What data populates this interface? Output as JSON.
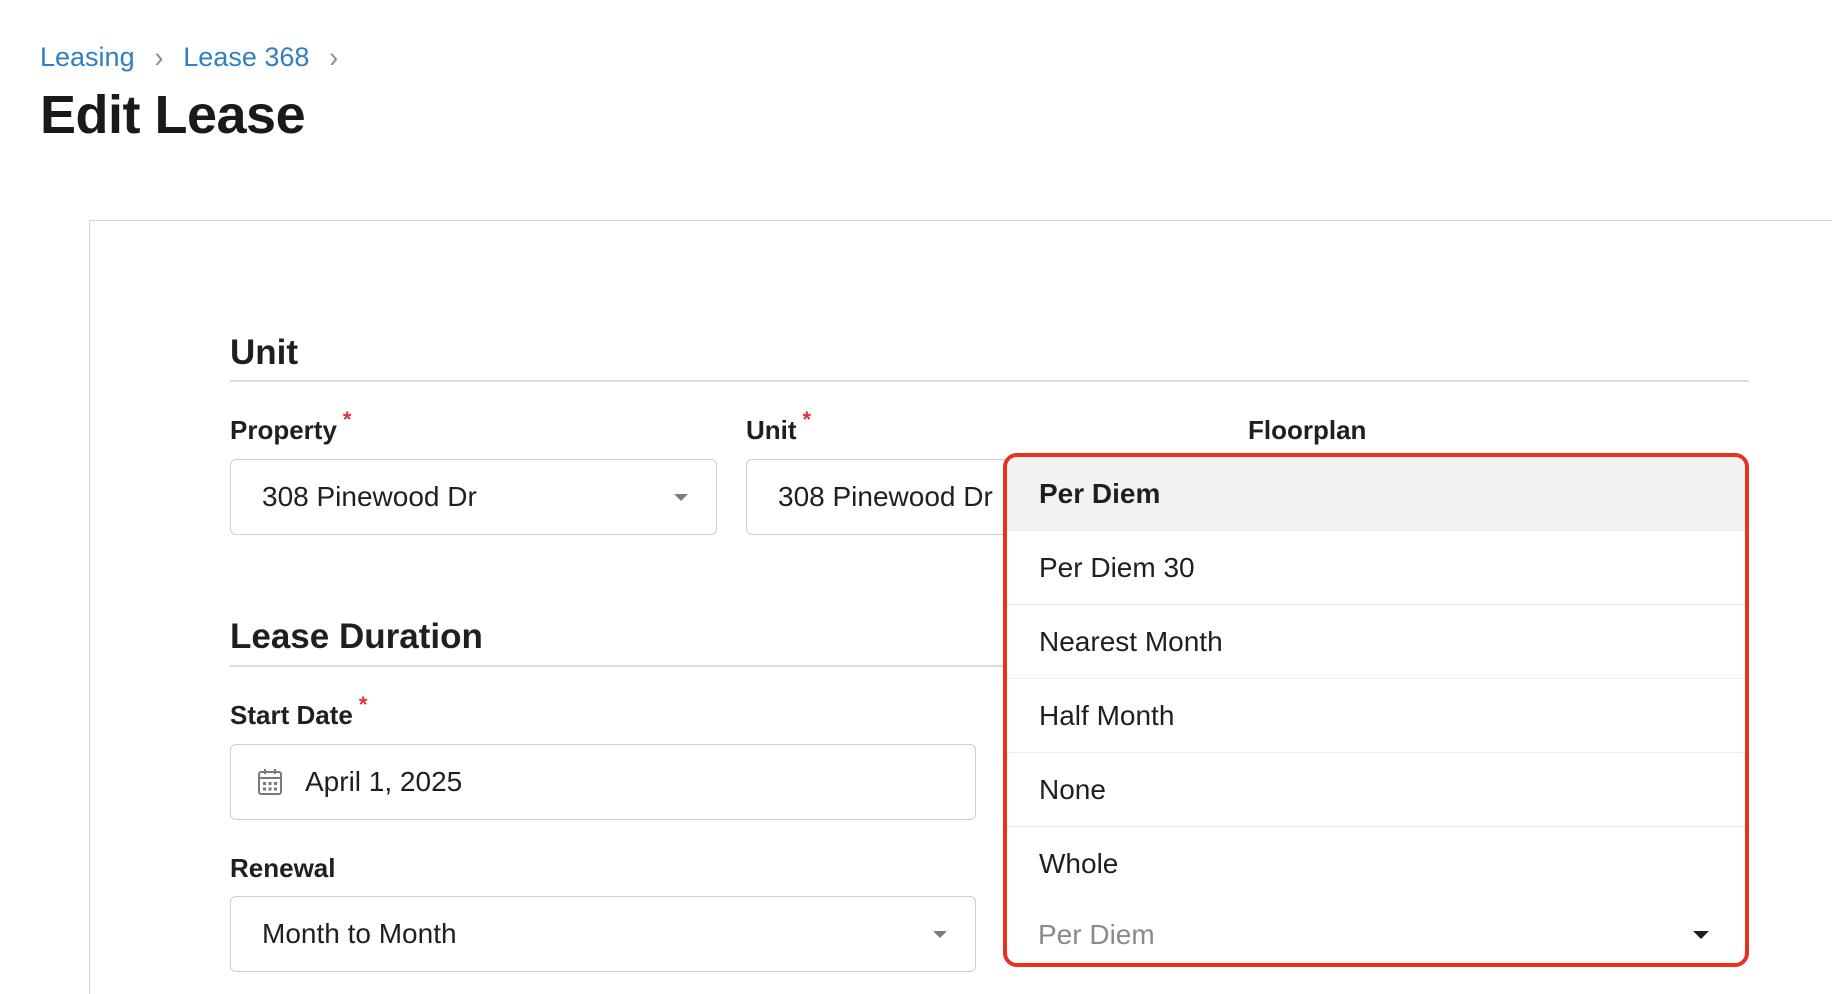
{
  "breadcrumb": {
    "items": [
      {
        "label": "Leasing"
      },
      {
        "label": "Lease 368"
      }
    ],
    "separator": "›"
  },
  "page": {
    "title": "Edit Lease"
  },
  "unit_section": {
    "title": "Unit",
    "property": {
      "label": "Property",
      "required_mark": "*",
      "value": "308 Pinewood Dr"
    },
    "unit": {
      "label": "Unit",
      "required_mark": "*",
      "value": "308 Pinewood Dr"
    },
    "floorplan": {
      "label": "Floorplan"
    }
  },
  "lease_duration_section": {
    "title": "Lease Duration",
    "start_date": {
      "label": "Start Date",
      "required_mark": "*",
      "value": "April 1, 2025",
      "icon": "calendar-icon"
    },
    "renewal": {
      "label": "Renewal",
      "value": "Month to Month"
    }
  },
  "proration_dropdown": {
    "options": [
      {
        "label": "Per Diem",
        "active": true
      },
      {
        "label": "Per Diem 30"
      },
      {
        "label": "Nearest Month"
      },
      {
        "label": "Half Month"
      },
      {
        "label": "None"
      },
      {
        "label": "Whole"
      }
    ],
    "selected_value": "Per Diem",
    "highlight_color": "#e8311e"
  },
  "colors": {
    "link": "#2f7fc1",
    "required": "#e0303a",
    "active_option_bg": "#f2f2f2"
  }
}
